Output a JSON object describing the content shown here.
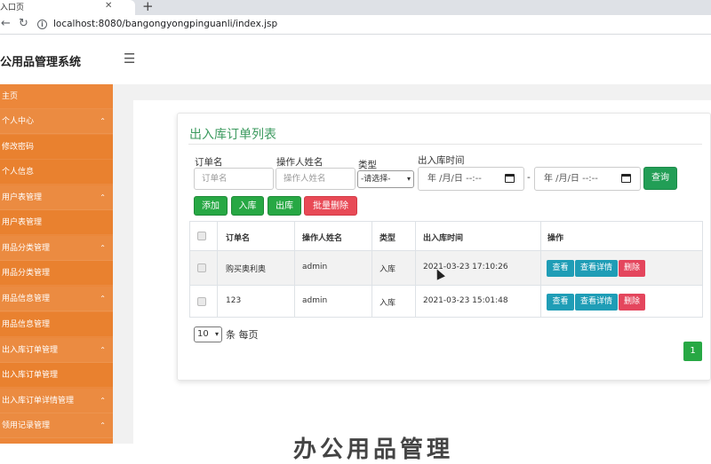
{
  "browser": {
    "tab_title": "入口页",
    "url": "localhost:8080/bangongyongpinguanli/index.jsp"
  },
  "header": {
    "brand": "公用品管理系统"
  },
  "sidebar": {
    "items": [
      {
        "label": "主页"
      },
      {
        "label": "个人中心"
      },
      {
        "label": "修改密码"
      },
      {
        "label": "个人信息"
      },
      {
        "label": "用户表管理"
      },
      {
        "label": "用户表管理"
      },
      {
        "label": "用品分类管理"
      },
      {
        "label": "用品分类管理"
      },
      {
        "label": "用品信息管理"
      },
      {
        "label": "用品信息管理"
      },
      {
        "label": "出入库订单管理"
      },
      {
        "label": "出入库订单管理"
      },
      {
        "label": "出入库订单详情管理"
      },
      {
        "label": "领用记录管理"
      }
    ]
  },
  "main": {
    "card_title": "出入库订单列表",
    "filters": {
      "order_label": "订单名",
      "order_placeholder": "订单名",
      "operator_label": "操作人姓名",
      "operator_placeholder": "操作人姓名",
      "type_label": "类型",
      "type_selected": "-请选择-",
      "time_label": "出入库时间",
      "date_from": "年 /月/日 --:--",
      "date_sep": "-",
      "date_to": "年 /月/日 --:--",
      "search_label": "查询"
    },
    "actions": {
      "add": "添加",
      "in": "入库",
      "out": "出库",
      "batch_delete": "批量删除"
    },
    "table": {
      "headers": [
        "订单名",
        "操作人姓名",
        "类型",
        "出入库时间",
        "操作"
      ],
      "rows": [
        {
          "order": "购买奥利奥",
          "operator": "admin",
          "type": "入库",
          "time": "2021-03-23 17:10:26"
        },
        {
          "order": "123",
          "operator": "admin",
          "type": "入库",
          "time": "2021-03-23 15:01:48"
        }
      ],
      "row_actions": {
        "view": "查看",
        "view_detail": "查看详情",
        "delete": "删除"
      }
    },
    "pagination": {
      "page_size": "10",
      "page_size_suffix": "条 每页",
      "current_page": "1"
    }
  },
  "footer_text": "办公用品管理",
  "colors": {
    "sidebar": "#ec873a",
    "accent_green": "#27a844",
    "danger_red": "#e84a56",
    "info_teal": "#1f9db6"
  }
}
